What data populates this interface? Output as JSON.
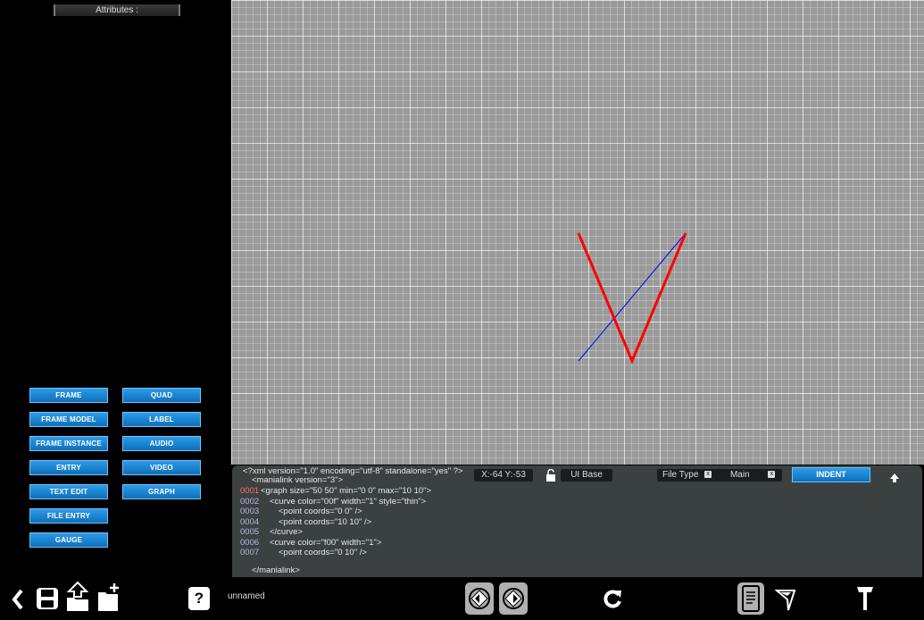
{
  "left_panel": {
    "attributes_label": "Attributes :",
    "buttons_col1": [
      "FRAME",
      "FRAME MODEL",
      "FRAME INSTANCE",
      "ENTRY",
      "TEXT EDIT",
      "FILE ENTRY",
      "GAUGE"
    ],
    "buttons_col2": [
      "QUAD",
      "LABEL",
      "AUDIO",
      "VIDEO",
      "GRAPH"
    ]
  },
  "canvas": {
    "graph": {
      "size": "50 50",
      "min": "0 0",
      "max": "10 10",
      "curves": [
        {
          "color": "#0000ff",
          "points": [
            [
              0,
              0
            ],
            [
              10,
              10
            ]
          ]
        },
        {
          "color": "#ff0000",
          "points": [
            [
              0,
              10
            ],
            [
              5,
              0
            ],
            [
              10,
              10
            ]
          ]
        }
      ]
    }
  },
  "editor": {
    "xml_decl": "<?xml version=\"1.0\" encoding=\"utf-8\" standalone=\"yes\" ?>",
    "manialink_open": "<manialink version=\"3\">",
    "manialink_close": "</manialink>",
    "lines": [
      {
        "num": "0001",
        "text": "<graph size=\"50 50\" min=\"0 0\" max=\"10 10\">",
        "indent": 0
      },
      {
        "num": "0002",
        "text": "<curve color=\"00f\" width=\"1\" style=\"thin\">",
        "indent": 1
      },
      {
        "num": "0003",
        "text": "<point coords=\"0 0\" />",
        "indent": 2
      },
      {
        "num": "0004",
        "text": "<point coords=\"10 10\" />",
        "indent": 2
      },
      {
        "num": "0005",
        "text": "</curve>",
        "indent": 1
      },
      {
        "num": "0006",
        "text": "<curve color=\"f00\" width=\"1\">",
        "indent": 1
      },
      {
        "num": "0007",
        "text": "<point coords=\"0 10\" />",
        "indent": 2
      }
    ],
    "coords": "X:-64  Y:-53",
    "ui_base": "UI Base",
    "file_type_label": "File Type",
    "file_type_value": "Main",
    "x_mark": "x",
    "indent_label": "INDENT"
  },
  "bottom_bar": {
    "filename": "unnamed",
    "help": "?"
  }
}
